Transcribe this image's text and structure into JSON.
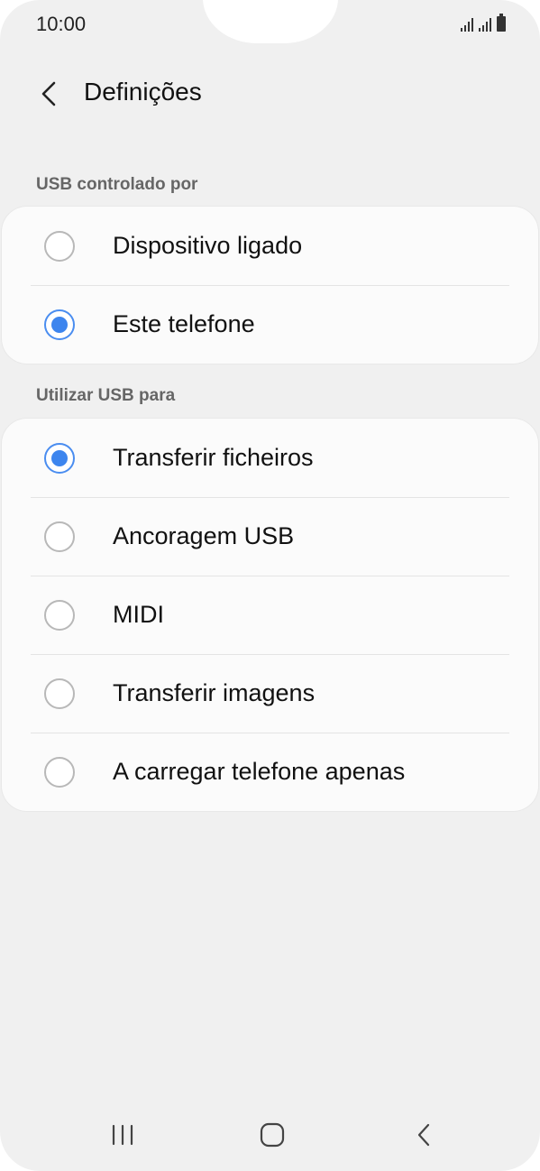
{
  "status": {
    "time": "10:00"
  },
  "header": {
    "title": "Definições"
  },
  "sections": [
    {
      "label": "USB controlado por",
      "options": [
        {
          "label": "Dispositivo ligado",
          "selected": false
        },
        {
          "label": "Este telefone",
          "selected": true
        }
      ]
    },
    {
      "label": "Utilizar USB para",
      "options": [
        {
          "label": "Transferir ficheiros",
          "selected": true
        },
        {
          "label": "Ancoragem USB",
          "selected": false
        },
        {
          "label": "MIDI",
          "selected": false
        },
        {
          "label": "Transferir imagens",
          "selected": false
        },
        {
          "label": "A carregar telefone apenas",
          "selected": false
        }
      ]
    }
  ],
  "colors": {
    "accent": "#3d85ee",
    "background": "#f0f0f0",
    "card": "#fbfbfb"
  },
  "icons": {
    "back": "chevron-left-icon",
    "recents": "recent-apps-icon",
    "home": "home-icon",
    "nav_back": "back-icon"
  }
}
